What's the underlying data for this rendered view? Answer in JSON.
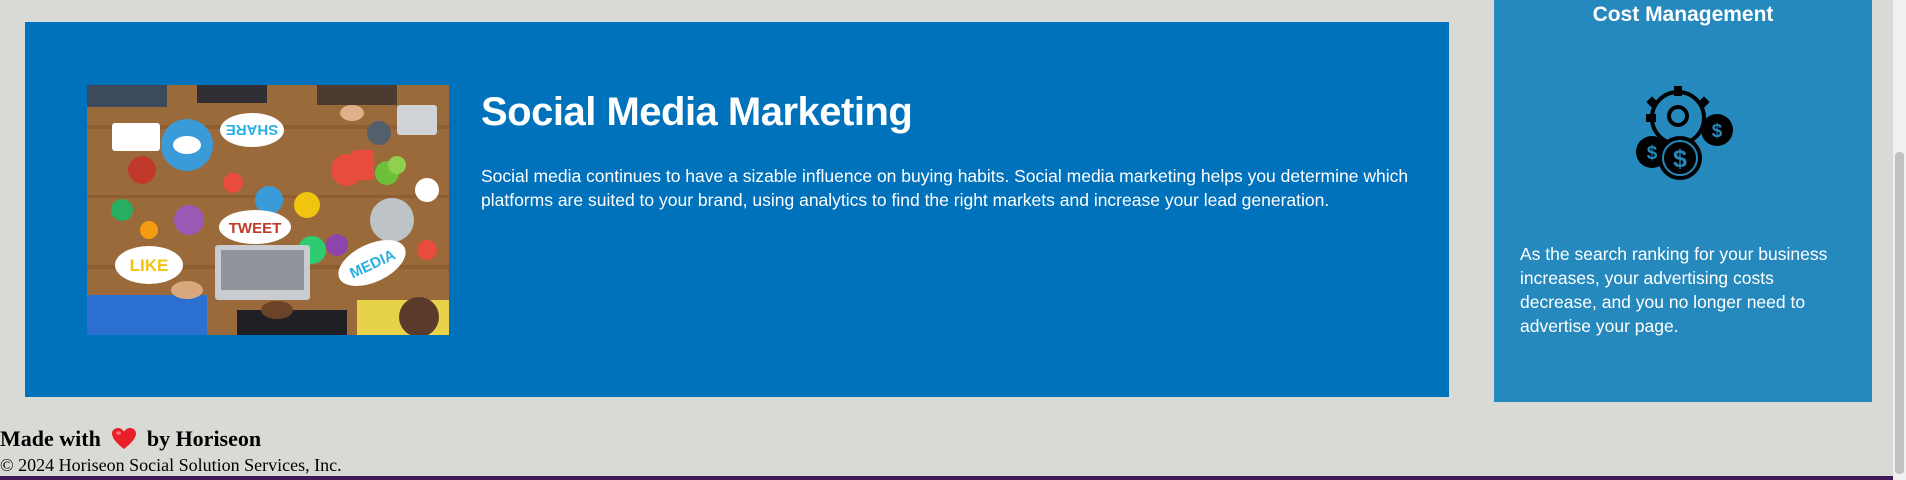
{
  "main_card": {
    "title": "Social Media Marketing",
    "text": "Social media continues to have a sizable influence on buying habits. Social media marketing helps you determine which platforms are suited to your brand, using analytics to find the right markets and increase your lead generation.",
    "image_words": {
      "share": "SHARE",
      "tweet": "TWEET",
      "like": "LIKE",
      "media": "MEDIA"
    },
    "background_color": "#0072bb"
  },
  "side_card": {
    "title": "Cost Management",
    "icon": "cost-management-icon",
    "text": "As the search ranking for your business increases, your advertising costs decrease, and you no longer need to advertise your page.",
    "background_color": "#2589bd"
  },
  "footer": {
    "made_with": "Made with",
    "by": "by Horiseon",
    "heart_icon": "heart-icon",
    "copyright": "© 2024 Horiseon Social Solution Services, Inc."
  }
}
